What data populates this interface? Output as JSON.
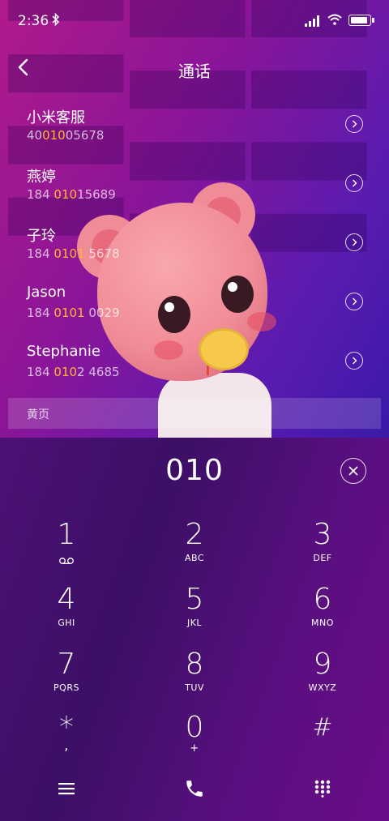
{
  "status_bar": {
    "time": "2:36",
    "bluetooth_icon": "bluetooth-icon",
    "signal_icon": "signal-icon",
    "wifi_icon": "wifi-icon",
    "battery_icon": "battery-icon"
  },
  "header": {
    "title": "通话",
    "back_icon": "chevron-left-icon"
  },
  "contacts": [
    {
      "name": "小米客服",
      "num_pre": "40",
      "num_hl": "010",
      "num_post": "05678"
    },
    {
      "name": "燕婷",
      "num_pre": "184 ",
      "num_hl": "010",
      "num_post": "15689"
    },
    {
      "name": "子玲",
      "num_pre": "184 ",
      "num_hl": "0101",
      "num_post": " 5678"
    },
    {
      "name": "Jason",
      "num_pre": "184 ",
      "num_hl": "0101",
      "num_post": " 0029"
    },
    {
      "name": "Stephanie",
      "num_pre": "184 ",
      "num_hl": "010",
      "num_post": "2 4685"
    }
  ],
  "yellow_pages": "黄页",
  "dialer": {
    "input": "010",
    "keys": [
      {
        "digit": "1",
        "letters": ""
      },
      {
        "digit": "2",
        "letters": "ABC"
      },
      {
        "digit": "3",
        "letters": "DEF"
      },
      {
        "digit": "4",
        "letters": "GHI"
      },
      {
        "digit": "5",
        "letters": "JKL"
      },
      {
        "digit": "6",
        "letters": "MNO"
      },
      {
        "digit": "7",
        "letters": "PQRS"
      },
      {
        "digit": "8",
        "letters": "TUV"
      },
      {
        "digit": "9",
        "letters": "WXYZ"
      },
      {
        "digit": "*",
        "letters": ","
      },
      {
        "digit": "0",
        "letters": "+"
      },
      {
        "digit": "#",
        "letters": ""
      }
    ]
  },
  "colors": {
    "highlight": "#ffb62e",
    "dialer_bg": "#4d1176"
  }
}
